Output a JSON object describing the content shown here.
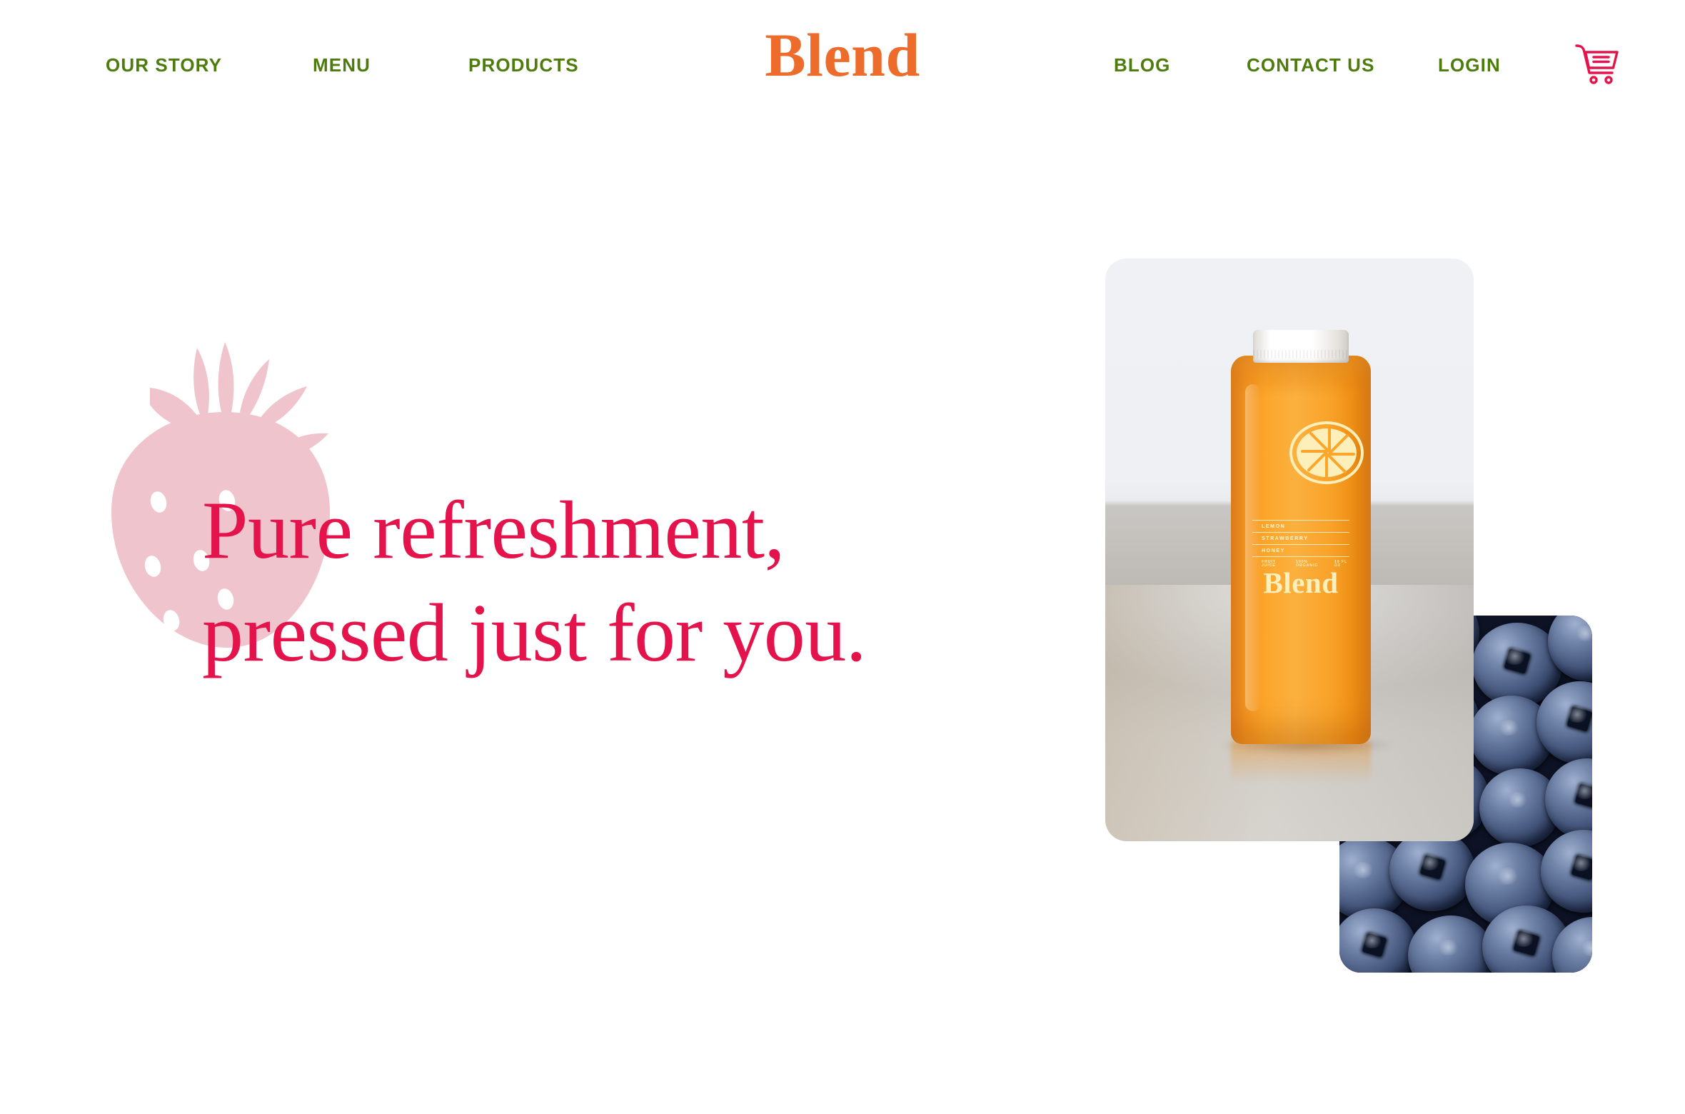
{
  "brand": {
    "name": "Blend",
    "logo_color": "#ee6c2b"
  },
  "nav": {
    "left_items": [
      {
        "label": "OUR STORY",
        "name": "nav-item-our-story"
      },
      {
        "label": "MENU",
        "name": "nav-item-menu"
      },
      {
        "label": "PRODUCTS",
        "name": "nav-item-products"
      }
    ],
    "right_items": [
      {
        "label": "BLOG",
        "name": "nav-item-blog"
      },
      {
        "label": "CONTACT US",
        "name": "nav-item-contact-us"
      },
      {
        "label": "LOGIN",
        "name": "nav-item-login"
      }
    ],
    "link_color": "#4d7c0c",
    "cart_icon": "shopping-cart-icon",
    "cart_color": "#e4134b"
  },
  "hero": {
    "headline_line1": "Pure refreshment,",
    "headline_line2": "pressed just for you.",
    "headline_color": "#e4134b",
    "decoration": {
      "shape": "strawberry-icon",
      "fill": "#f0c4cc",
      "seed_fill": "#ffffff"
    },
    "images": [
      {
        "name": "bottle-photo",
        "alt": "Orange juice bottle on a concrete table",
        "product_label": {
          "wordmark": "Blend",
          "mark": "lemon-slice-icon",
          "ingredients": [
            "LEMON",
            "STRAWBERRY",
            "HONEY"
          ],
          "meta": [
            "FRUIT JUICE",
            "100% ORGANIC",
            "16 FL OZ"
          ]
        }
      },
      {
        "name": "blueberries-photo",
        "alt": "Close-up of fresh blueberries"
      }
    ]
  }
}
